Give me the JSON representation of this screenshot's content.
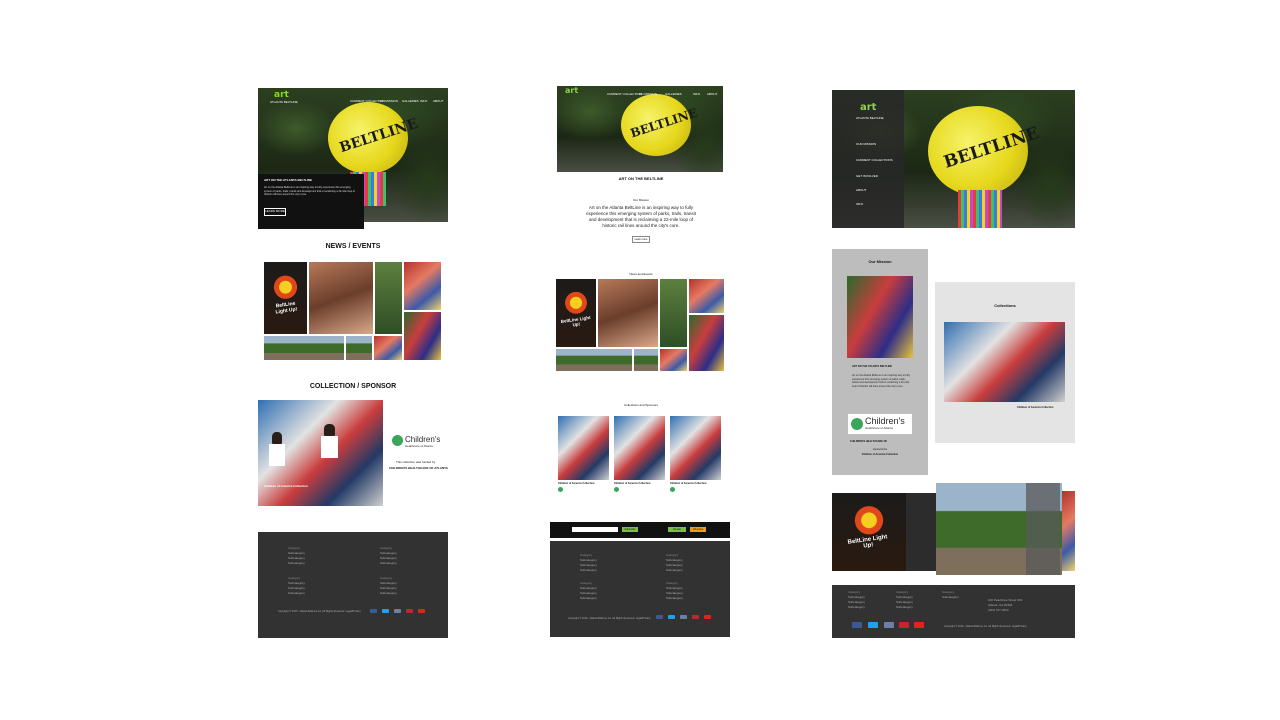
{
  "mockup_a": {
    "logo": "art",
    "logo_sub": "ATLANTA BELTLINE",
    "nav": [
      "CURRENT COLLECTION",
      "ON MISSION",
      "GALLERIES",
      "INFO",
      "ABOUT"
    ],
    "lantern_text": "BELTLINE",
    "hero_title": "ART ON THE ATLANTA BELTLINE",
    "hero_body": "Art on the Atlanta BeltLine is an inspiring way to fully experience this emerging system of parks, trails, transit and development that is reclaiming a 22-mile loop of historic rail lines around the city's core.",
    "hero_button": "LEARN MORE",
    "news_heading": "NEWS / EVENTS",
    "bird_sign": "BeltLine Light Up!",
    "collection_heading": "COLLECTION / SPONSOR",
    "collection_caption": "Children of America Collection",
    "sponsor_logo": "Children's",
    "sponsor_logo_sub": "Healthcare of Atlanta",
    "sponsor_line1": "This collection was funded by",
    "sponsor_line2": "CHILDREN'S HEALTHCARE OF ATLANTA",
    "footer_cols": [
      {
        "title": "Category",
        "links": [
          "Subcategory",
          "Subcategory",
          "Subcategory"
        ]
      },
      {
        "title": "Category",
        "links": [
          "Subcategory",
          "Subcategory",
          "Subcategory"
        ]
      },
      {
        "title": "Category",
        "links": [
          "Subcategory",
          "Subcategory",
          "Subcategory"
        ]
      },
      {
        "title": "Category",
        "links": [
          "Subcategory",
          "Subcategory",
          "Subcategory"
        ]
      }
    ],
    "copyright": "Copyright © 2015 - Atlanta BeltLine Inc. All Rights Reserved. Legal/Privacy"
  },
  "mockup_b": {
    "logo": "art",
    "nav": [
      "CURRENT COLLECTION",
      "ON MISSION",
      "GALLERIES",
      "INFO",
      "ABOUT"
    ],
    "lantern_text": "BELTLINE",
    "title": "ART ON THE BELTLINE",
    "mission_label": "Our Mission",
    "mission_body": "Art on the Atlanta BeltLine is an inspiring way to fully experience this emerging system of parks, trails, transit and development that is reclaiming a 22-mile loop of historic rail lines around the city's core.",
    "mission_button": "Learn more",
    "news_label": "News and Events",
    "bird_sign": "BeltLine Light Up!",
    "collections_label": "Collections and Sponsors",
    "cards": [
      {
        "caption": "Children of America Collection"
      },
      {
        "caption": "Children of America Collection"
      },
      {
        "caption": "Children of America Collection"
      }
    ],
    "subscribe_button": "Subscribe",
    "btn_a": "Donate",
    "btn_b": "Volunteer",
    "footer_cols": [
      {
        "title": "Category",
        "links": [
          "Subcategory",
          "Subcategory",
          "Subcategory"
        ]
      },
      {
        "title": "Category",
        "links": [
          "Subcategory",
          "Subcategory",
          "Subcategory"
        ]
      },
      {
        "title": "Category",
        "links": [
          "Subcategory",
          "Subcategory",
          "Subcategory"
        ]
      },
      {
        "title": "Category",
        "links": [
          "Subcategory",
          "Subcategory",
          "Subcategory"
        ]
      }
    ],
    "copyright": "Copyright © 2015 - Atlanta BeltLine Inc. All Rights Reserved. Legal/Privacy"
  },
  "mockup_c": {
    "logo": "art",
    "logo_sub": "ATLANTA BELTLINE",
    "side_nav": [
      "OUR MISSION",
      "CURRENT COLLECTIONS",
      "GET INVOLVED",
      "ABOUT",
      "INFO"
    ],
    "lantern_text": "BELTLINE",
    "mission_heading": "Our Mission",
    "mission_title": "ART ON THE ATLANTA BELTLINE",
    "mission_body": "Art on the Atlanta BeltLine is an inspiring way to fully experience this emerging system of parks, trails, transit and development that is reclaiming a 22-mile loop of historic rail lines around the city's core.",
    "sponsor_logo": "Children's",
    "sponsor_logo_sub": "Healthcare of Atlanta",
    "sponsor_title": "CHILDREN'S HEALTHCARE OF",
    "sponsor_line": "sponsors the",
    "sponsor_collection": "Children of America Collection",
    "collections_heading": "Collections",
    "collections_caption": "Children of America Collection",
    "bird_sign": "BeltLine Light Up!",
    "footer_cols": [
      {
        "title": "Category",
        "links": [
          "Subcategory",
          "Subcategory",
          "Subcategory"
        ]
      },
      {
        "title": "Category",
        "links": [
          "Subcategory",
          "Subcategory",
          "Subcategory"
        ]
      },
      {
        "title": "Category",
        "links": [
          "Subcategory"
        ]
      }
    ],
    "address": [
      "100 Peachtree Street NW",
      "Atlanta, GA 30303",
      "(404) 477-3003"
    ],
    "copyright": "Copyright © 2015 - Atlanta BeltLine Inc. All Rights Reserved. Legal/Privacy"
  },
  "social_colors": [
    "#3b5998",
    "#1da1f2",
    "#6b7fa8",
    "#c8232c",
    "#e62117"
  ],
  "social_icons": [
    "facebook-icon",
    "twitter-icon",
    "google-plus-icon",
    "pinterest-icon",
    "youtube-icon"
  ]
}
